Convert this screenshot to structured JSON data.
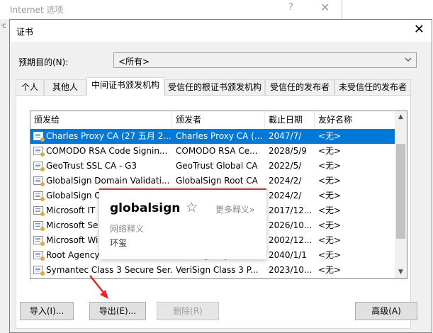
{
  "background_window": {
    "title": "Internet 选项",
    "help_glyph": "?",
    "close_glyph": "✕",
    "edge_fragment": "·c"
  },
  "dialog": {
    "title": "证书",
    "close_glyph": "✕",
    "purpose_label": "预期目的(N):",
    "purpose_value": "<所有>",
    "tabs": [
      {
        "label": "个人"
      },
      {
        "label": "其他人"
      },
      {
        "label": "中间证书颁发机构",
        "active": true
      },
      {
        "label": "受信任的根证书颁发机构"
      },
      {
        "label": "受信任的发布者"
      },
      {
        "label": "未受信任的发布者"
      }
    ],
    "columns": [
      "颁发给",
      "颁发者",
      "截止日期",
      "友好名称"
    ],
    "rows": [
      {
        "issued_to": "Charles Proxy CA (27 五月 2...",
        "issuer": "Charles Proxy CA (...",
        "expires": "2047/7/",
        "friendly": "<无>",
        "selected": true
      },
      {
        "issued_to": "COMODO RSA Code Signin...",
        "issuer": "COMODO RSA Ce...",
        "expires": "2028/5/9",
        "friendly": "<无>"
      },
      {
        "issued_to": "GeoTrust SSL CA - G3",
        "issuer": "GeoTrust Global CA",
        "expires": "2022/5/",
        "friendly": "<无>"
      },
      {
        "issued_to": "GlobalSign Domain Validati...",
        "issuer": "GlobalSign Root CA",
        "expires": "2024/2/",
        "friendly": "<无>"
      },
      {
        "issued_to": "GlobalSign O",
        "issuer": "",
        "expires": "2024/2/",
        "friendly": "<无>"
      },
      {
        "issued_to": "Microsoft IT",
        "issuer": "",
        "expires": "2017/12...",
        "friendly": "<无>"
      },
      {
        "issued_to": "Microsoft Se",
        "issuer": "",
        "expires": "2026/10...",
        "friendly": "<无>"
      },
      {
        "issued_to": "Microsoft Wi",
        "issuer": "",
        "expires": "2002/12...",
        "friendly": "<无>"
      },
      {
        "issued_to": "Root Agency",
        "issuer": "Root Agency",
        "expires": "2040/1/1",
        "friendly": "<无>"
      },
      {
        "issued_to": "Symantec Class 3 Secure Ser...",
        "issuer": "VeriSign Class 3 P...",
        "expires": "2023/10...",
        "friendly": "<无>"
      }
    ],
    "buttons": {
      "import": "导入(I)...",
      "export": "导出(E)...",
      "remove": "删除(R)",
      "advanced": "高级(A)"
    }
  },
  "dictionary_popup": {
    "word": "globalsign",
    "star_glyph": "☆",
    "more_label": "更多释义»",
    "section_label": "网络释义",
    "meaning": "环玺"
  },
  "colors": {
    "selection": "#0078d7",
    "annotation_arrow": "#e8262a",
    "popup_accent": "#c0392b"
  }
}
